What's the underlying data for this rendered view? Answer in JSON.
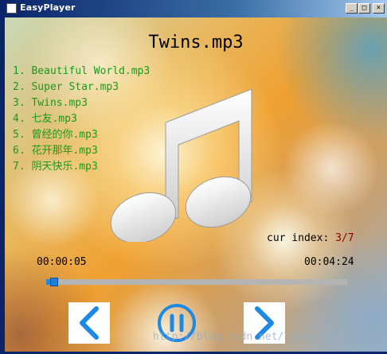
{
  "window": {
    "title": "EasyPlayer",
    "controls": {
      "minimize": "_",
      "maximize": "□",
      "close": "×"
    }
  },
  "player": {
    "current_title": "Twins.mp3",
    "playlist": [
      "1. Beautiful World.mp3",
      "2. Super Star.mp3",
      "3. Twins.mp3",
      "4. 七友.mp3",
      "5. 曾经的你.mp3",
      "6. 花开那年.mp3",
      "7. 阴天快乐.mp3"
    ],
    "cur_index_label": "cur index:",
    "cur_index_value": "3/7",
    "time_current": "00:00:05",
    "time_total": "00:04:24",
    "progress_fraction": 0.019
  },
  "controls": {
    "prev_icon": "chevron-left-icon",
    "pause_icon": "pause-icon",
    "next_icon": "chevron-right-icon"
  },
  "watermark": "http://blog.csdn.net/ljmao_bok",
  "colors": {
    "accent": "#1e88e5",
    "playlist_text": "#1a9a1a",
    "index_value": "#8b0000",
    "titlebar": "#0a246a"
  }
}
